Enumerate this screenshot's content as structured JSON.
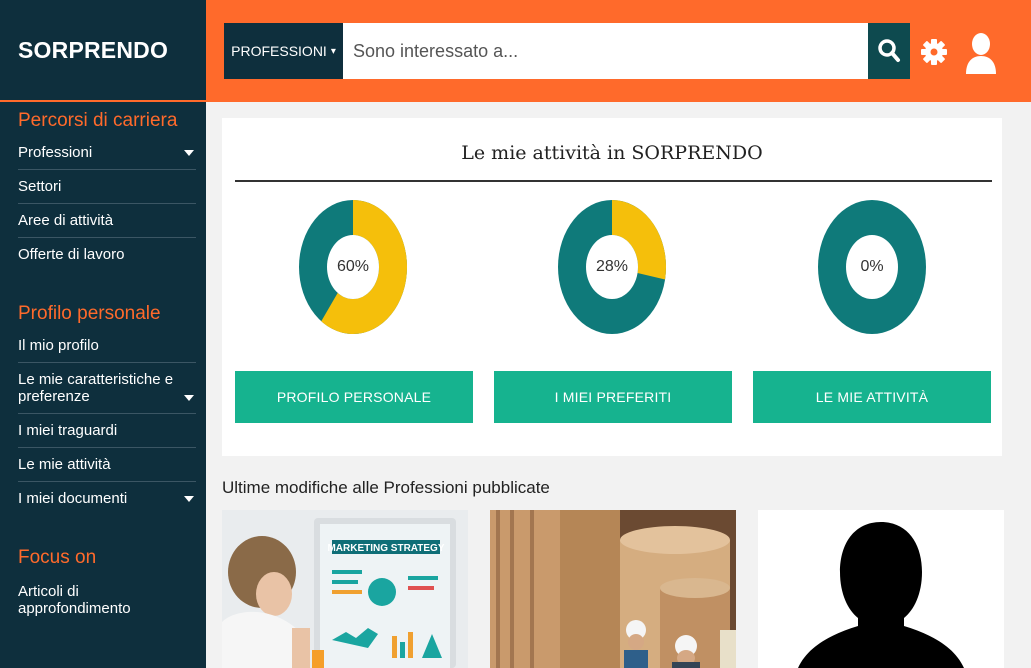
{
  "brand": "SORPRENDO",
  "sidebar": {
    "sections": [
      {
        "title": "Percorsi di carriera",
        "items": [
          {
            "label": "Professioni",
            "has_caret": true
          },
          {
            "label": "Settori",
            "has_caret": false
          },
          {
            "label": "Aree di attività",
            "has_caret": false
          },
          {
            "label": "Offerte di lavoro",
            "has_caret": false
          }
        ]
      },
      {
        "title": "Profilo personale",
        "items": [
          {
            "label": "Il mio profilo",
            "has_caret": false
          },
          {
            "label": "Le mie caratteristiche e preferenze",
            "has_caret": true
          },
          {
            "label": "I miei traguardi",
            "has_caret": false
          },
          {
            "label": "Le mie attività",
            "has_caret": false
          },
          {
            "label": "I miei documenti",
            "has_caret": true
          }
        ]
      },
      {
        "title": "Focus on",
        "items": [
          {
            "label": "Articoli di approfondimento",
            "has_caret": false
          }
        ]
      }
    ]
  },
  "topbar": {
    "category_button": "PROFESSIONI",
    "search_placeholder": "Sono interessato a...",
    "search_icon": "search-icon",
    "settings_icon": "gear-icon",
    "user_icon": "user-icon"
  },
  "activity": {
    "title": "Le mie attività in SORPRENDO",
    "donuts": [
      {
        "label": "60%",
        "value": 0.6
      },
      {
        "label": "28%",
        "value": 0.28
      },
      {
        "label": "0%",
        "value": 0.0
      }
    ],
    "buttons": [
      "PROFILO PERSONALE",
      "I MIEI PREFERITI",
      "LE MIE ATTIVITÀ"
    ]
  },
  "latest": {
    "title": "Ultime modifiche alle Professioni pubblicate",
    "thumb_texts": [
      "MARKETING STRATEGY"
    ]
  },
  "colors": {
    "brand_orange": "#ff6a2b",
    "navy": "#0e2f3d",
    "teal_dark": "#0f7a7a",
    "yellow": "#f5bf0b",
    "green_button": "#16b38f"
  }
}
